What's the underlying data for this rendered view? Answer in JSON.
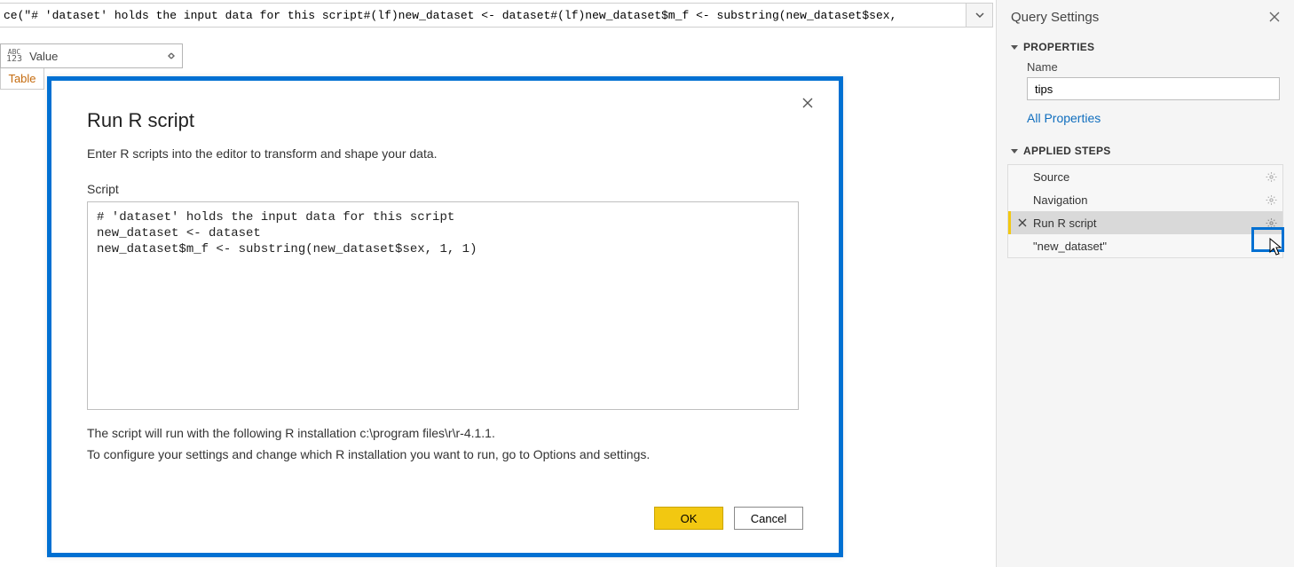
{
  "formula_bar": "ce(\"# 'dataset' holds the input data for this script#(lf)new_dataset <- dataset#(lf)new_dataset$m_f <- substring(new_dataset$sex,",
  "columns": [
    {
      "name": "Value",
      "type": "ABC123"
    }
  ],
  "rows": [
    {
      "value": "Table"
    }
  ],
  "dialog": {
    "title": "Run R script",
    "subtitle": "Enter R scripts into the editor to transform and shape your data.",
    "script_label": "Script",
    "script": "# 'dataset' holds the input data for this script\nnew_dataset <- dataset\nnew_dataset$m_f <- substring(new_dataset$sex, 1, 1)",
    "note1": "The script will run with the following R installation c:\\program files\\r\\r-4.1.1.",
    "note2": "To configure your settings and change which R installation you want to run, go to Options and settings.",
    "ok": "OK",
    "cancel": "Cancel"
  },
  "right": {
    "title": "Query Settings",
    "section_properties": "PROPERTIES",
    "name_label": "Name",
    "name_value": "tips",
    "all_properties": "All Properties",
    "section_steps": "APPLIED STEPS",
    "steps": {
      "s0": "Source",
      "s1": "Navigation",
      "s2": "Run R script",
      "s3": "\"new_dataset\""
    }
  }
}
